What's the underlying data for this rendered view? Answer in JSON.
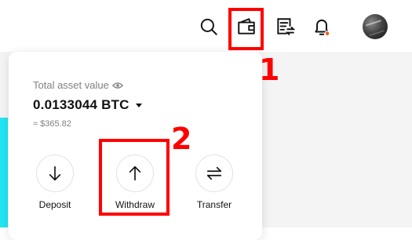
{
  "header": {
    "icons": [
      "search-icon",
      "wallet-icon",
      "orders-icon",
      "bell-icon"
    ],
    "notification_dot_color": "#f35b1a"
  },
  "wallet_dropdown": {
    "total_label": "Total asset value",
    "balance": "0.0133044 BTC",
    "fiat_value": "≈ $365.82",
    "actions": [
      {
        "label": "Deposit",
        "icon": "arrow-down-icon"
      },
      {
        "label": "Withdraw",
        "icon": "arrow-up-icon"
      },
      {
        "label": "Transfer",
        "icon": "swap-arrows-icon"
      }
    ]
  },
  "annotations": {
    "step1": "1",
    "step2": "2",
    "color": "#ff0000"
  },
  "colors": {
    "accent_strip": "#22e5f3",
    "text_primary": "#121212",
    "text_secondary": "#808080"
  }
}
